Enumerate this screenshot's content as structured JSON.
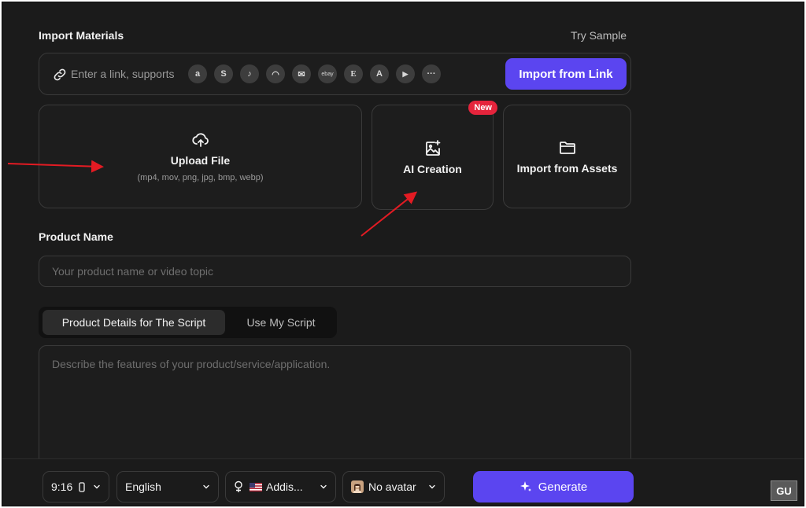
{
  "import_materials": {
    "title": "Import Materials",
    "try_sample": "Try Sample",
    "link_input": {
      "placeholder": "Enter a link, supports",
      "value": ""
    },
    "platforms": [
      {
        "name": "amazon-icon",
        "glyph": "a"
      },
      {
        "name": "shopify-icon",
        "glyph": "S"
      },
      {
        "name": "shopping-bag-icon",
        "glyph": "♪"
      },
      {
        "name": "lazada-icon",
        "glyph": "◠"
      },
      {
        "name": "mail-icon",
        "glyph": "✉"
      },
      {
        "name": "ebay-icon",
        "glyph": "ebay"
      },
      {
        "name": "etsy-icon",
        "glyph": "E"
      },
      {
        "name": "app-store-icon",
        "glyph": "A"
      },
      {
        "name": "play-store-icon",
        "glyph": "▶"
      },
      {
        "name": "more-icon",
        "glyph": "···"
      }
    ],
    "import_link_button": "Import from Link"
  },
  "upload_card": {
    "title": "Upload File",
    "subtitle": "(mp4, mov, png, jpg, bmp, webp)"
  },
  "ai_card": {
    "title": "AI Creation",
    "badge": "New"
  },
  "assets_card": {
    "title": "Import from Assets"
  },
  "product_name": {
    "label": "Product Name",
    "placeholder": "Your product name or video topic",
    "value": ""
  },
  "script_tabs": {
    "tabs": [
      "Product Details for The Script",
      "Use My Script"
    ],
    "active": 0
  },
  "description": {
    "placeholder": "Describe the features of your product/service/application.",
    "value": ""
  },
  "bottom_bar": {
    "ratio": "9:16",
    "language": "English",
    "voice": "Addis...",
    "avatar": "No avatar",
    "generate": "Generate"
  },
  "watermark": "GU",
  "colors": {
    "accent": "#5b45f0",
    "badge": "#e5243c",
    "background": "#1b1b1b",
    "annotation_arrow": "#e31b23"
  }
}
